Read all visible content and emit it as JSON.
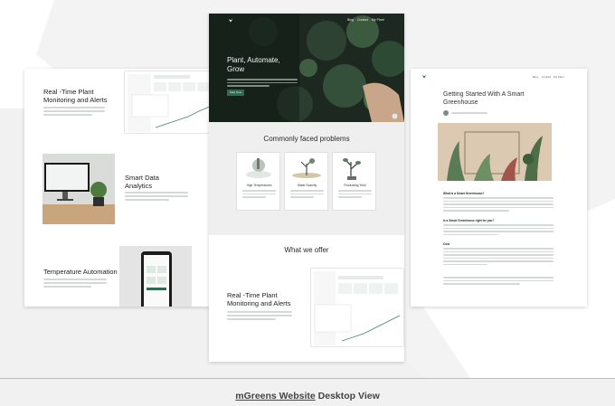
{
  "colors": {
    "accent": "#2f6b52",
    "hero_bg": "#1f2a22",
    "page_bg": "#f1f1f1"
  },
  "left": {
    "feature1_title": "Real -Time Plant Monitoring and Alerts",
    "feature2_title": "Smart Data Analytics",
    "feature3_title": "Temperature Automation"
  },
  "center": {
    "nav": [
      "Blog",
      "Contact",
      "My Plant"
    ],
    "hero_title": "Plant, Automate, Grow",
    "hero_button": "Start Now",
    "problems_title": "Commonly faced problems",
    "problems": [
      {
        "name": "High Temperatures",
        "icon": "thermometer-plant-icon"
      },
      {
        "name": "Water Scarcity",
        "icon": "dry-tree-icon"
      },
      {
        "name": "Fluctuating Yield",
        "icon": "wilting-plant-icon"
      }
    ],
    "offer_title": "What we offer",
    "offer_feature_title": "Real -Time Plant Monitoring and Alerts"
  },
  "right": {
    "nav": [
      "Blog",
      "Contact",
      "My Plant"
    ],
    "article_title": "Getting Started With A Smart Greenhouse",
    "headings": [
      "What is a Smart Greenhouse?",
      "Is a Smart Greenhouse right for you?",
      "Cost"
    ]
  },
  "caption": {
    "brand": "mGreens Website",
    "rest": " Desktop View"
  }
}
